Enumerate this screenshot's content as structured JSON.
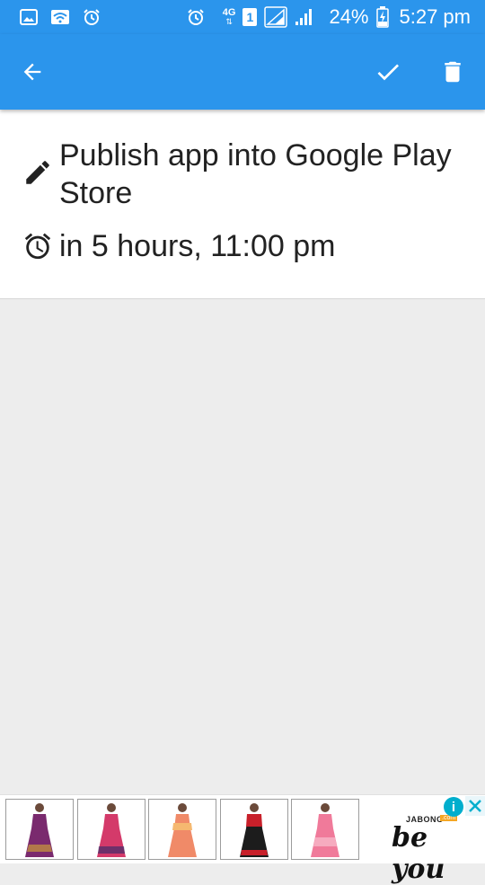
{
  "status_bar": {
    "network_type": "4G",
    "sim_slot": "1",
    "battery_percent": "24%",
    "time": "5:27 pm",
    "icons": [
      "image-icon",
      "wifi-icon",
      "alarm-icon",
      "alarm-icon",
      "signal-icon",
      "signal-icon",
      "battery-charging-icon"
    ]
  },
  "app_bar": {
    "back_icon": "arrow-back-icon",
    "done_icon": "check-icon",
    "delete_icon": "trash-icon"
  },
  "task": {
    "title": "Publish app into Google Play Store",
    "title_icon": "pencil-icon",
    "reminder": "in 5 hours, 11:00 pm",
    "reminder_icon": "alarm-clock-icon"
  },
  "ad": {
    "brand": "JABONG",
    "brand_badge": ".com",
    "tagline": "be you",
    "info_icon": "info-icon",
    "close_icon": "close-icon",
    "thumbnails": [
      {
        "color": "#7a2a6e"
      },
      {
        "color": "#d43a6a"
      },
      {
        "color": "#f08a68"
      },
      {
        "color": "#1c1c1c"
      },
      {
        "color": "#f07a9a"
      }
    ]
  },
  "colors": {
    "primary": "#2b95ec",
    "card_bg": "#ffffff",
    "page_bg": "#ededed",
    "text": "#222222"
  }
}
